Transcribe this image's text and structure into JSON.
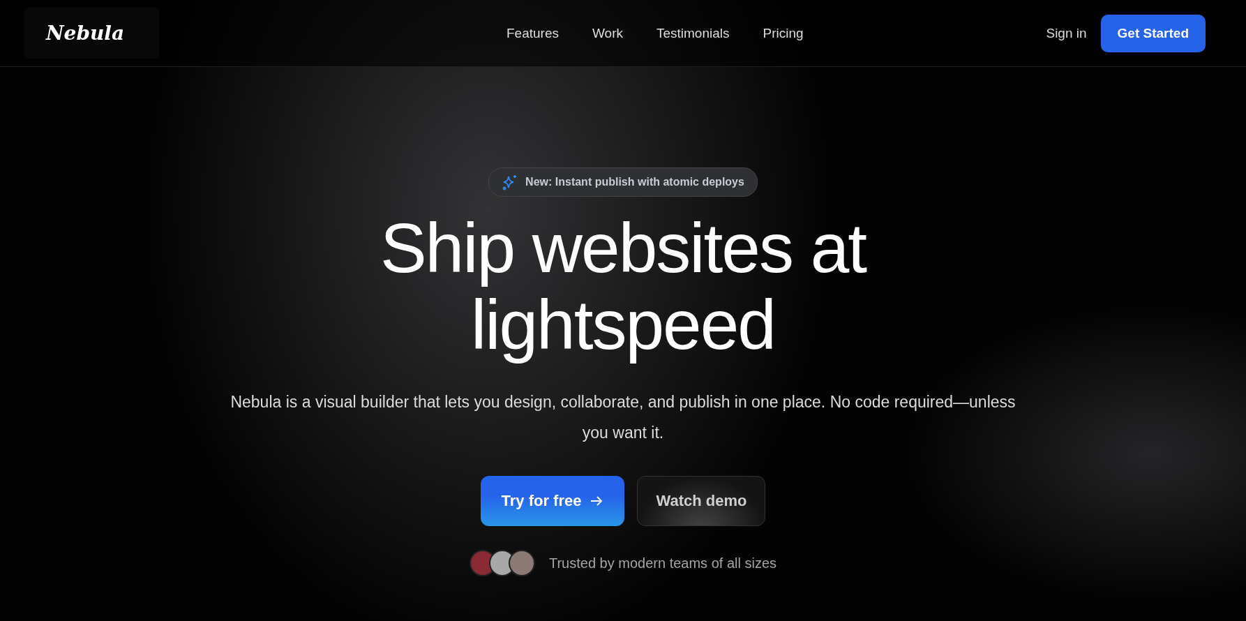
{
  "nav": {
    "logo": "Nebula",
    "links": [
      "Features",
      "Work",
      "Testimonials",
      "Pricing"
    ],
    "sign_in": "Sign in",
    "cta": "Get Started"
  },
  "hero": {
    "badge": "New: Instant publish with atomic deploys",
    "title_lines": [
      "Ship websites at",
      "lightspeed"
    ],
    "subtitle": "Nebula is a visual builder that lets you design, collaborate, and publish in one place. No code required—unless you want it.",
    "primary_button": "Try for free",
    "secondary_button": "Watch demo",
    "avatars": [
      {
        "color": "#8a2a34"
      },
      {
        "color": "#a8a8a8"
      },
      {
        "color": "#8c7a74"
      }
    ],
    "trust_text": "Trusted by modern teams of all sizes"
  }
}
